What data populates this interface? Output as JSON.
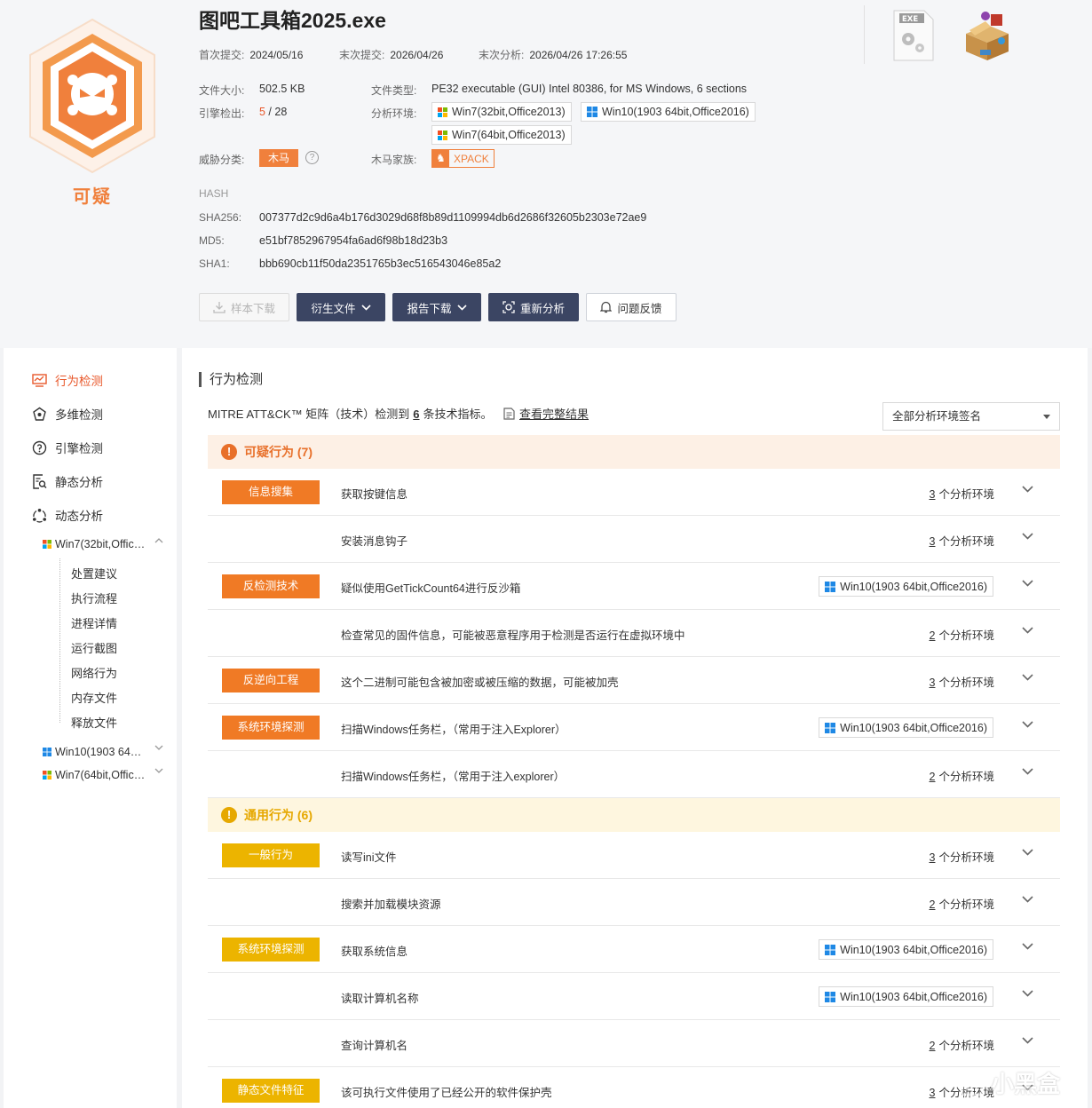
{
  "header": {
    "verdict": "可疑",
    "file_name": "图吧工具箱2025.exe",
    "first_submit_label": "首次提交:",
    "first_submit": "2024/05/16",
    "last_submit_label": "末次提交:",
    "last_submit": "2026/04/26",
    "last_analysis_label": "末次分析:",
    "last_analysis": "2026/04/26 17:26:55",
    "size_label": "文件大小:",
    "size": "502.5 KB",
    "engine_label": "引擎检出:",
    "engine_hits": "5",
    "engine_total": " / 28",
    "type_label": "文件类型:",
    "type": "PE32 executable (GUI) Intel 80386, for MS Windows, 6 sections",
    "env_label": "分析环境:",
    "envs": [
      "Win7(32bit,Office2013)",
      "Win10(1903 64bit,Office2016)",
      "Win7(64bit,Office2013)"
    ],
    "threat_label": "威胁分类:",
    "threat": "木马",
    "family_label": "木马家族:",
    "family": "XPACK",
    "hash_title": "HASH",
    "sha256_label": "SHA256:",
    "sha256": "007377d2c9d6a4b176d3029d68f8b89d1109994db6d2686f32605b2303e72ae9",
    "md5_label": "MD5:",
    "md5": "e51bf7852967954fa6ad6f98b18d23b3",
    "sha1_label": "SHA1:",
    "sha1": "bbb690cb11f50da2351765b3ec516543046e85a2",
    "exe_icon_label": "EXE"
  },
  "buttons": {
    "download": "样本下载",
    "derived": "衍生文件",
    "report": "报告下载",
    "reanalyze": "重新分析",
    "feedback": "问题反馈"
  },
  "sidebar": {
    "items": [
      {
        "label": "行为检测",
        "icon": "behavior-icon",
        "active": true
      },
      {
        "label": "多维检测",
        "icon": "multi-dimension-icon"
      },
      {
        "label": "引擎检测",
        "icon": "engine-icon"
      },
      {
        "label": "静态分析",
        "icon": "static-analysis-icon"
      },
      {
        "label": "动态分析",
        "icon": "dynamic-analysis-icon"
      }
    ],
    "env_tree": [
      {
        "label": "Win7(32bit,Office2013)",
        "os": "win7",
        "expanded": true
      },
      {
        "label": "Win10(1903 64bit,Office2016)",
        "os": "win10"
      },
      {
        "label": "Win7(64bit,Office2013)",
        "os": "win7"
      }
    ],
    "sub_items": [
      "处置建议",
      "执行流程",
      "进程详情",
      "运行截图",
      "网络行为",
      "内存文件",
      "释放文件"
    ]
  },
  "main": {
    "section_title": "行为检测",
    "mitre_prefix": "MITRE ATT&CK™ 矩阵（技术）检测到",
    "mitre_count": "6",
    "mitre_suffix": "条技术指标。",
    "mitre_link": "查看完整结果",
    "signature_select": "全部分析环境签名",
    "suspicious_header": "可疑行为 (7)",
    "general_header": "通用行为 (6)",
    "env_count_suffix": "个分析环境",
    "suspicious_rows": [
      {
        "category": "信息搜集",
        "desc": "获取按键信息",
        "count": "3"
      },
      {
        "category": "",
        "desc": "安装消息钩子",
        "count": "3"
      },
      {
        "category": "反检测技术",
        "desc": "疑似使用GetTickCount64进行反沙箱",
        "env": "Win10(1903 64bit,Office2016)"
      },
      {
        "category": "",
        "desc": "检查常见的固件信息，可能被恶意程序用于检测是否运行在虚拟环境中",
        "count": "2"
      },
      {
        "category": "反逆向工程",
        "desc": "这个二进制可能包含被加密或被压缩的数据，可能被加壳",
        "count": "3"
      },
      {
        "category": "系统环境探测",
        "desc": "扫描Windows任务栏，（常用于注入Explorer）",
        "env": "Win10(1903 64bit,Office2016)"
      },
      {
        "category": "",
        "desc": "扫描Windows任务栏，（常用于注入explorer）",
        "count": "2"
      }
    ],
    "general_rows": [
      {
        "category": "一般行为",
        "desc": "读写ini文件",
        "count": "3"
      },
      {
        "category": "",
        "desc": "搜索并加载模块资源",
        "count": "2"
      },
      {
        "category": "系统环境探测",
        "desc": "获取系统信息",
        "env": "Win10(1903 64bit,Office2016)"
      },
      {
        "category": "",
        "desc": "读取计算机名称",
        "env": "Win10(1903 64bit,Office2016)"
      },
      {
        "category": "",
        "desc": "查询计算机名",
        "count": "2"
      },
      {
        "category": "静态文件特征",
        "desc": "该可执行文件使用了已经公开的软件保护壳",
        "count": "3"
      }
    ]
  },
  "watermark": "小黑盒",
  "colors": {
    "suspicious_orange": "#f07a25",
    "general_yellow": "#ecb400",
    "button_dark": "#3b4563",
    "active_red": "#e8572a"
  }
}
